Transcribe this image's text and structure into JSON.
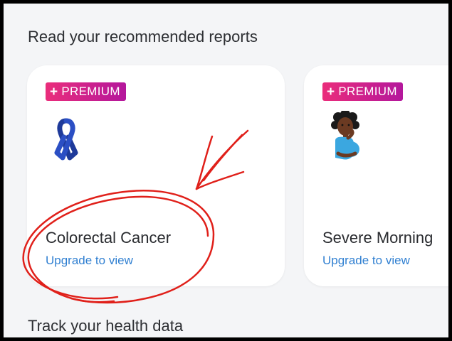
{
  "sections": {
    "recommended_title": "Read your recommended reports",
    "health_title": "Track your health data"
  },
  "cards": [
    {
      "badge": "PREMIUM",
      "badge_plus": "+",
      "icon": "awareness-ribbon-icon",
      "title": "Colorectal Cancer",
      "link": "Upgrade to view"
    },
    {
      "badge": "PREMIUM",
      "badge_plus": "+",
      "icon": "pregnant-woman-icon",
      "title": "Severe Morning",
      "link": "Upgrade to view"
    }
  ],
  "colors": {
    "background": "#f4f5f7",
    "card": "#ffffff",
    "badge_gradient_start": "#ea2d7b",
    "badge_gradient_end": "#b4179c",
    "link": "#2f7fd1",
    "annotation": "#e0201a"
  }
}
